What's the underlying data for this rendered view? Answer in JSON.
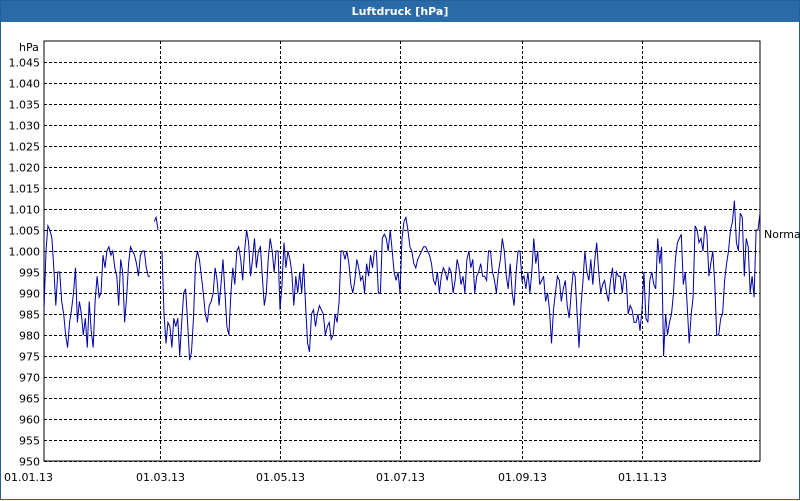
{
  "window": {
    "title": "Luftdruck [hPa]"
  },
  "chart_data": {
    "type": "line",
    "title": "Luftdruck [hPa]",
    "ylabel": "hPa",
    "xlabel": "",
    "ylim": [
      950,
      1050
    ],
    "xlim": [
      "2013-01-01",
      "2013-12-31"
    ],
    "yticks": [
      "950",
      "955",
      "960",
      "965",
      "970",
      "975",
      "980",
      "985",
      "990",
      "995",
      "1.000",
      "1.005",
      "1.010",
      "1.015",
      "1.020",
      "1.025",
      "1.030",
      "1.035",
      "1.040",
      "1.045"
    ],
    "ytick_values": [
      950,
      955,
      960,
      965,
      970,
      975,
      980,
      985,
      990,
      995,
      1000,
      1005,
      1010,
      1015,
      1020,
      1025,
      1030,
      1035,
      1040,
      1045
    ],
    "xticks": [
      "01.01.13",
      "01.03.13",
      "01.05.13",
      "01.07.13",
      "01.09.13",
      "01.11.13"
    ],
    "xtick_dates": [
      "2013-01-01",
      "2013-03-01",
      "2013-05-01",
      "2013-07-01",
      "2013-09-01",
      "2013-11-01"
    ],
    "grid": true,
    "reference_line": {
      "label": "Normal",
      "value": 1004
    },
    "colors": {
      "line": "#0000a8",
      "title_bar": "#2a6aa7",
      "grid": "#000000"
    },
    "series": [
      {
        "segments": [
          {
            "x": [
              "2013-01-01",
              "2013-01-02",
              "2013-01-03",
              "2013-01-04",
              "2013-01-05",
              "2013-01-06",
              "2013-01-07",
              "2013-01-08",
              "2013-01-09",
              "2013-01-10",
              "2013-01-11",
              "2013-01-12",
              "2013-01-13",
              "2013-01-14",
              "2013-01-15",
              "2013-01-16",
              "2013-01-17",
              "2013-01-18",
              "2013-01-19",
              "2013-01-20",
              "2013-01-21",
              "2013-01-22",
              "2013-01-23",
              "2013-01-24",
              "2013-01-25",
              "2013-01-26",
              "2013-01-27",
              "2013-01-28",
              "2013-01-29",
              "2013-01-30",
              "2013-01-31",
              "2013-02-01",
              "2013-02-02",
              "2013-02-03",
              "2013-02-04",
              "2013-02-05",
              "2013-02-06",
              "2013-02-07",
              "2013-02-08",
              "2013-02-09",
              "2013-02-10",
              "2013-02-11",
              "2013-02-12",
              "2013-02-13",
              "2013-02-14",
              "2013-02-15",
              "2013-02-16",
              "2013-02-17",
              "2013-02-18",
              "2013-02-19",
              "2013-02-20",
              "2013-02-21",
              "2013-02-22",
              "2013-02-23",
              "2013-02-24"
            ],
            "y": [
              986,
              1000,
              1006,
              1005,
              1003,
              996,
              987,
              995,
              995,
              988,
              985,
              980,
              977,
              983,
              986,
              990,
              996,
              983,
              988,
              985,
              980,
              984,
              977,
              988,
              981,
              977,
              988,
              994,
              989,
              990,
              999,
              996,
              1000,
              1001,
              999,
              1000,
              996,
              994,
              987,
              998,
              995,
              983,
              989,
              997,
              1001,
              1000,
              999,
              997,
              994,
              999,
              1000,
              1000,
              996,
              994,
              994
            ]
          },
          {
            "x": [
              "2013-02-26",
              "2013-02-27",
              "2013-02-28"
            ],
            "y": [
              1007,
              1008,
              1005
            ]
          },
          {
            "x": [
              "2013-03-02",
              "2013-03-03",
              "2013-03-04",
              "2013-03-05",
              "2013-03-06",
              "2013-03-07",
              "2013-03-08",
              "2013-03-09",
              "2013-03-10",
              "2013-03-11",
              "2013-03-12",
              "2013-03-13",
              "2013-03-14",
              "2013-03-15",
              "2013-03-16",
              "2013-03-17",
              "2013-03-18",
              "2013-03-19",
              "2013-03-20",
              "2013-03-21",
              "2013-03-22",
              "2013-03-23",
              "2013-03-24",
              "2013-03-25",
              "2013-03-26",
              "2013-03-27",
              "2013-03-28",
              "2013-03-29",
              "2013-03-30",
              "2013-03-31",
              "2013-04-01",
              "2013-04-02",
              "2013-04-03",
              "2013-04-04",
              "2013-04-05",
              "2013-04-06",
              "2013-04-07",
              "2013-04-08",
              "2013-04-09",
              "2013-04-10",
              "2013-04-11",
              "2013-04-12",
              "2013-04-13",
              "2013-04-14",
              "2013-04-15",
              "2013-04-16",
              "2013-04-17",
              "2013-04-18",
              "2013-04-19",
              "2013-04-20",
              "2013-04-21",
              "2013-04-22",
              "2013-04-23",
              "2013-04-24",
              "2013-04-25",
              "2013-04-26",
              "2013-04-27",
              "2013-04-28",
              "2013-04-29",
              "2013-04-30",
              "2013-05-01",
              "2013-05-02",
              "2013-05-03",
              "2013-05-04",
              "2013-05-05",
              "2013-05-06",
              "2013-05-07",
              "2013-05-08",
              "2013-05-09",
              "2013-05-10",
              "2013-05-11",
              "2013-05-12",
              "2013-05-13",
              "2013-05-14",
              "2013-05-15",
              "2013-05-16",
              "2013-05-17",
              "2013-05-18",
              "2013-05-19",
              "2013-05-20",
              "2013-05-21",
              "2013-05-22",
              "2013-05-23",
              "2013-05-24",
              "2013-05-25",
              "2013-05-26",
              "2013-05-27",
              "2013-05-28",
              "2013-05-29",
              "2013-05-30",
              "2013-05-31",
              "2013-06-01",
              "2013-06-02",
              "2013-06-03",
              "2013-06-04",
              "2013-06-05",
              "2013-06-06",
              "2013-06-07",
              "2013-06-08",
              "2013-06-09",
              "2013-06-10",
              "2013-06-11",
              "2013-06-12",
              "2013-06-13",
              "2013-06-14",
              "2013-06-15",
              "2013-06-16",
              "2013-06-17",
              "2013-06-18",
              "2013-06-19",
              "2013-06-20",
              "2013-06-21",
              "2013-06-22",
              "2013-06-23",
              "2013-06-24",
              "2013-06-25",
              "2013-06-26",
              "2013-06-27",
              "2013-06-28",
              "2013-06-29",
              "2013-06-30",
              "2013-07-01",
              "2013-07-02",
              "2013-07-03",
              "2013-07-04",
              "2013-07-05",
              "2013-07-06",
              "2013-07-07",
              "2013-07-08",
              "2013-07-09",
              "2013-07-10",
              "2013-07-11",
              "2013-07-12",
              "2013-07-13",
              "2013-07-14",
              "2013-07-15",
              "2013-07-16",
              "2013-07-17",
              "2013-07-18",
              "2013-07-19",
              "2013-07-20",
              "2013-07-21",
              "2013-07-22",
              "2013-07-23",
              "2013-07-24",
              "2013-07-25",
              "2013-07-26",
              "2013-07-27",
              "2013-07-28",
              "2013-07-29",
              "2013-07-30",
              "2013-07-31",
              "2013-08-01",
              "2013-08-02",
              "2013-08-03",
              "2013-08-04",
              "2013-08-05",
              "2013-08-06",
              "2013-08-07",
              "2013-08-08",
              "2013-08-09",
              "2013-08-10",
              "2013-08-11",
              "2013-08-12",
              "2013-08-13",
              "2013-08-14",
              "2013-08-15",
              "2013-08-16",
              "2013-08-17",
              "2013-08-18",
              "2013-08-19",
              "2013-08-20",
              "2013-08-21",
              "2013-08-22",
              "2013-08-23",
              "2013-08-24",
              "2013-08-25",
              "2013-08-26",
              "2013-08-27",
              "2013-08-28",
              "2013-08-29",
              "2013-08-30",
              "2013-08-31",
              "2013-09-01",
              "2013-09-02",
              "2013-09-03",
              "2013-09-04",
              "2013-09-05",
              "2013-09-06",
              "2013-09-07",
              "2013-09-08",
              "2013-09-09",
              "2013-09-10",
              "2013-09-11",
              "2013-09-12",
              "2013-09-13",
              "2013-09-14",
              "2013-09-15",
              "2013-09-16",
              "2013-09-17",
              "2013-09-18",
              "2013-09-19",
              "2013-09-20",
              "2013-09-21",
              "2013-09-22",
              "2013-09-23",
              "2013-09-24",
              "2013-09-25",
              "2013-09-26",
              "2013-09-27",
              "2013-09-28",
              "2013-09-29",
              "2013-09-30",
              "2013-10-01",
              "2013-10-02",
              "2013-10-03",
              "2013-10-04",
              "2013-10-05",
              "2013-10-06",
              "2013-10-07",
              "2013-10-08",
              "2013-10-09",
              "2013-10-10",
              "2013-10-11",
              "2013-10-12",
              "2013-10-13",
              "2013-10-14",
              "2013-10-15",
              "2013-10-16",
              "2013-10-17",
              "2013-10-18",
              "2013-10-19",
              "2013-10-20",
              "2013-10-21",
              "2013-10-22",
              "2013-10-23",
              "2013-10-24",
              "2013-10-25",
              "2013-10-26",
              "2013-10-27",
              "2013-10-28",
              "2013-10-29",
              "2013-10-30",
              "2013-10-31",
              "2013-11-01",
              "2013-11-02",
              "2013-11-03",
              "2013-11-04",
              "2013-11-05",
              "2013-11-06",
              "2013-11-07",
              "2013-11-08",
              "2013-11-09",
              "2013-11-10",
              "2013-11-11",
              "2013-11-12",
              "2013-11-13",
              "2013-11-14",
              "2013-11-15",
              "2013-11-16",
              "2013-11-17",
              "2013-11-18",
              "2013-11-19",
              "2013-11-20",
              "2013-11-21",
              "2013-11-22",
              "2013-11-23",
              "2013-11-24",
              "2013-11-25",
              "2013-11-26",
              "2013-11-27",
              "2013-11-28",
              "2013-11-29",
              "2013-11-30",
              "2013-12-01",
              "2013-12-02",
              "2013-12-03",
              "2013-12-04",
              "2013-12-05",
              "2013-12-06",
              "2013-12-07",
              "2013-12-08",
              "2013-12-09",
              "2013-12-10",
              "2013-12-11",
              "2013-12-12",
              "2013-12-13",
              "2013-12-14",
              "2013-12-15",
              "2013-12-16",
              "2013-12-17",
              "2013-12-18",
              "2013-12-19",
              "2013-12-20",
              "2013-12-21",
              "2013-12-22",
              "2013-12-23",
              "2013-12-24",
              "2013-12-25",
              "2013-12-26",
              "2013-12-27",
              "2013-12-28",
              "2013-12-29",
              "2013-12-30",
              "2013-12-31"
            ],
            "y": [
              1000,
              985,
              978,
              983,
              982,
              977,
              984,
              982,
              984,
              975,
              983,
              990,
              991,
              983,
              974,
              976,
              984,
              997,
              1000,
              998,
              994,
              990,
              985,
              983,
              987,
              988,
              990,
              996,
              993,
              987,
              992,
              998,
              990,
              982,
              980,
              990,
              996,
              992,
              1000,
              1001,
              998,
              993,
              1000,
              1005,
              1002,
              994,
              998,
              1003,
              996,
              1000,
              1001,
              994,
              987,
              990,
              998,
              1003,
              1000,
              995,
              1000,
              1000,
              986,
              992,
              1002,
              996,
              1000,
              998,
              995,
              987,
              994,
              990,
              995,
              990,
              997,
              987,
              978,
              976,
              985,
              986,
              982,
              985,
              987,
              986,
              985,
              980,
              982,
              983,
              979,
              980,
              985,
              983,
              988,
              1000,
              1000,
              998,
              1000,
              997,
              992,
              990,
              993,
              998,
              996,
              993,
              994,
              990,
              997,
              994,
              999,
              996,
              1000,
              1000,
              990,
              990,
              1003,
              1004,
              1003,
              1000,
              1005,
              1000,
              995,
              993,
              995,
              990,
              1003,
              1007,
              1008,
              1005,
              1001,
              1000,
              997,
              996,
              998,
              999,
              1000,
              1001,
              1001,
              1000,
              999,
              997,
              993,
              992,
              995,
              990,
              994,
              996,
              995,
              993,
              996,
              995,
              990,
              993,
              998,
              996,
              992,
              994,
              990,
              998,
              1000,
              996,
              998,
              990,
              994,
              995,
              997,
              994,
              994,
              993,
              1000,
              1000,
              995,
              993,
              990,
              995,
              998,
              1003,
              1000,
              994,
              991,
              997,
              990,
              987,
              995,
              1000,
              1000,
              993,
              994,
              991,
              995,
              990,
              995,
              1003,
              997,
              1000,
              992,
              993,
              994,
              988,
              990,
              986,
              978,
              986,
              990,
              994,
              993,
              988,
              991,
              993,
              987,
              984,
              990,
              995,
              994,
              985,
              977,
              987,
              993,
              1000,
              995,
              993,
              998,
              992,
              998,
              1002,
              995,
              990,
              992,
              993,
              990,
              988,
              993,
              996,
              990,
              995,
              994,
              994,
              990,
              995,
              993,
              985,
              987,
              986,
              983,
              983,
              985,
              981,
              986,
              995,
              984,
              983,
              993,
              995,
              992,
              991,
              1003,
              997,
              1001,
              975,
              985,
              980,
              983,
              985,
              990,
              998,
              1002,
              1003,
              1004,
              992,
              995,
              987,
              978,
              985,
              989,
              1006,
              1005,
              1002,
              1003,
              1000,
              1006,
              1004,
              994,
              997,
              1000,
              992,
              980,
              980,
              984,
              985,
              993,
              997,
              1000,
              1005,
              1007,
              1012,
              1002,
              1000,
              1009,
              1008,
              994,
              1003,
              1001,
              990,
              994,
              989,
              1005,
              1005,
              1009,
              1003,
              1002,
              1007,
              1011,
              1008,
              1010,
              1006,
              1003,
              1000,
              1005,
              1003,
              1001,
              1002,
              990,
              995,
              1003,
              1000,
              994,
              981,
              975,
              981,
              983,
              984,
              993,
              1003,
              1002,
              1000
            ]
          }
        ]
      }
    ]
  }
}
